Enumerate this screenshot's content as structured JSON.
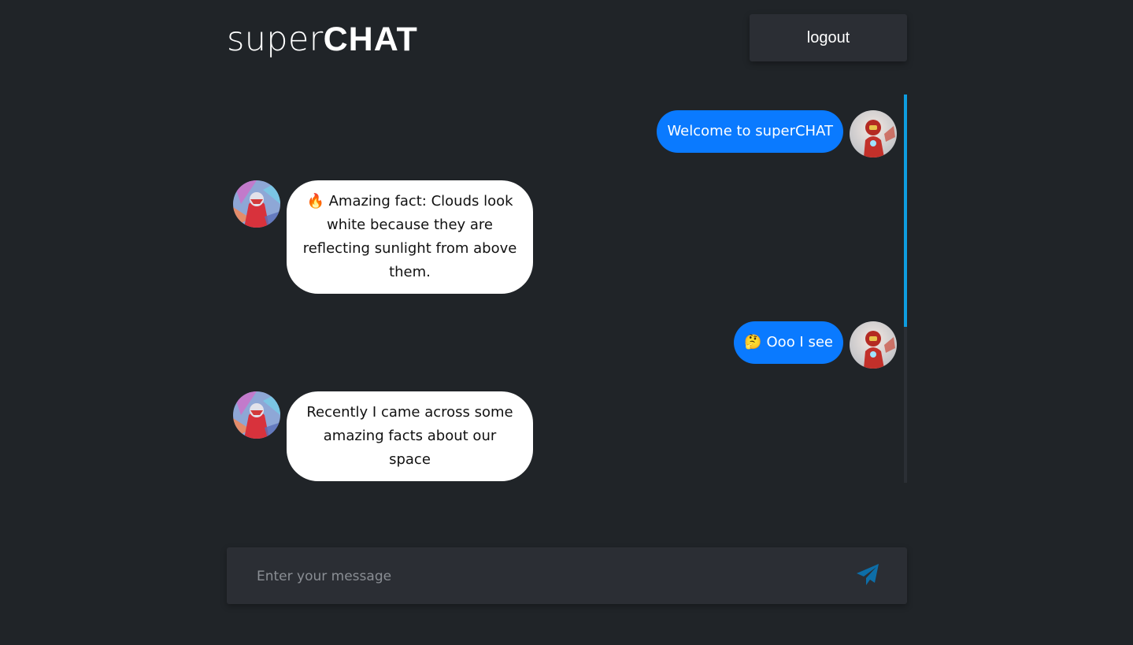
{
  "header": {
    "logo_light": "super",
    "logo_bold": "CHAT",
    "logout_label": "logout"
  },
  "messages": [
    {
      "direction": "sent",
      "emoji": "",
      "text": "Welcome to superCHAT",
      "avatar": "red-armored-hero-avatar"
    },
    {
      "direction": "received",
      "emoji": "🔥",
      "text": "Amazing fact: Clouds look white because they are reflecting sunlight from above them.",
      "avatar": "colorful-hero-avatar"
    },
    {
      "direction": "sent",
      "emoji": "🤔",
      "text": "Ooo I see",
      "avatar": "red-armored-hero-avatar"
    },
    {
      "direction": "received",
      "emoji": "",
      "text": "Recently I came across some amazing facts about our space",
      "avatar": "colorful-hero-avatar"
    }
  ],
  "composer": {
    "placeholder": "Enter your message",
    "send_icon": "paper-plane-icon"
  },
  "colors": {
    "background": "#202428",
    "panel": "#2b2e34",
    "sent_bubble": "#0a7aff",
    "received_bubble": "#ffffff",
    "scroll_thumb": "#0e9de0",
    "send_icon": "#0d6ea8"
  }
}
